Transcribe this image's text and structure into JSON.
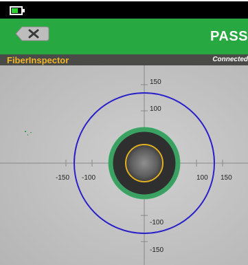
{
  "status": {
    "battery_icon": "battery-icon",
    "battery_color": "#2fd12f"
  },
  "header": {
    "back_icon": "back-x-icon",
    "result": "PASS",
    "color": "#27a841"
  },
  "title_bar": {
    "app_name": "FiberInspector",
    "connection": "Connected",
    "app_name_color": "#f2b62a"
  },
  "fiber_view": {
    "axis_ticks": [
      "150",
      "100",
      "-150",
      "-100",
      "100",
      "150",
      "-100",
      "-150"
    ],
    "zones": [
      {
        "name": "core",
        "color": "#e0b020",
        "radius_um": 25
      },
      {
        "name": "cladding",
        "color": "#3cb56b",
        "radius_um": 50
      },
      {
        "name": "contact",
        "color": "#2a22c8",
        "radius_um": 125
      }
    ]
  }
}
